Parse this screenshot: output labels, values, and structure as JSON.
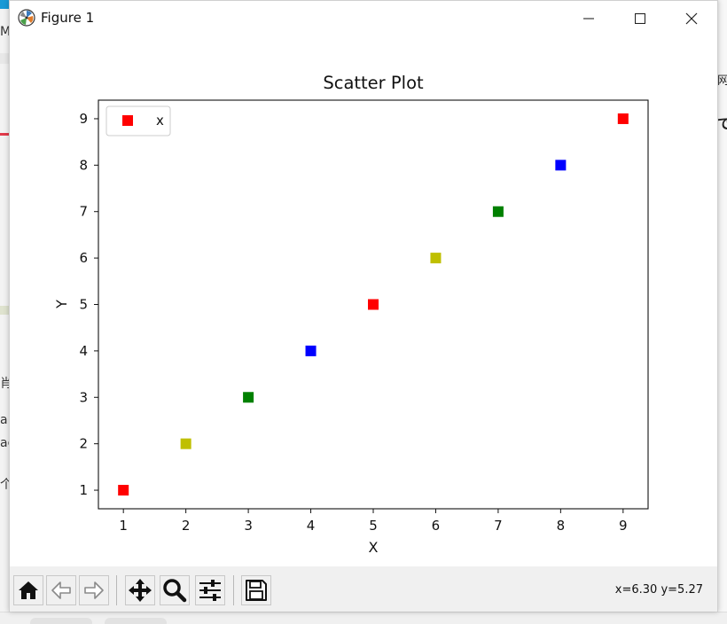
{
  "window": {
    "title": "Figure 1",
    "controls": [
      "minimize",
      "maximize",
      "close"
    ]
  },
  "toolbar": {
    "buttons": [
      {
        "name": "home",
        "icon": "home-icon"
      },
      {
        "name": "back",
        "icon": "arrow-left-icon"
      },
      {
        "name": "forward",
        "icon": "arrow-right-icon"
      },
      {
        "name": "pan",
        "icon": "move-icon"
      },
      {
        "name": "zoom",
        "icon": "magnifier-icon"
      },
      {
        "name": "configure-subplots",
        "icon": "sliders-icon"
      },
      {
        "name": "save",
        "icon": "floppy-icon"
      }
    ],
    "coordinates": "x=6.30 y=5.27"
  },
  "background": {
    "left_texts": [
      "M",
      "肖",
      "a",
      "ac",
      "个"
    ],
    "right_texts": [
      "网",
      "で"
    ]
  },
  "chart_data": {
    "type": "scatter",
    "title": "Scatter Plot",
    "xlabel": "X",
    "ylabel": "Y",
    "x_ticks": [
      1,
      2,
      3,
      4,
      5,
      6,
      7,
      8,
      9
    ],
    "y_ticks": [
      1,
      2,
      3,
      4,
      5,
      6,
      7,
      8,
      9
    ],
    "xlim": [
      0.6,
      9.4
    ],
    "ylim": [
      0.6,
      9.4
    ],
    "grid": false,
    "legend": {
      "placement": "upper left",
      "entries": [
        {
          "label": "x",
          "color": "#ff0000",
          "marker": "square"
        }
      ]
    },
    "marker": "square",
    "points": [
      {
        "x": 1,
        "y": 1,
        "color": "#ff0000"
      },
      {
        "x": 2,
        "y": 2,
        "color": "#bfbf00"
      },
      {
        "x": 3,
        "y": 3,
        "color": "#008000"
      },
      {
        "x": 4,
        "y": 4,
        "color": "#0000ff"
      },
      {
        "x": 5,
        "y": 5,
        "color": "#ff0000"
      },
      {
        "x": 6,
        "y": 6,
        "color": "#bfbf00"
      },
      {
        "x": 7,
        "y": 7,
        "color": "#008000"
      },
      {
        "x": 8,
        "y": 8,
        "color": "#0000ff"
      },
      {
        "x": 9,
        "y": 9,
        "color": "#ff0000"
      }
    ]
  }
}
